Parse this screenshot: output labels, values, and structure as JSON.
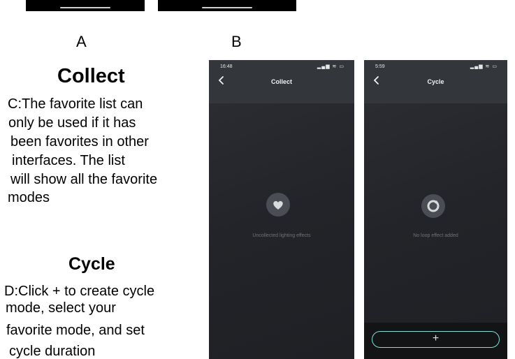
{
  "labels": {
    "a": "A",
    "b": "B"
  },
  "collect": {
    "title": "Collect",
    "lines": [
      "C:The favorite list can",
      "only  be used if it has",
      "been favorites in other",
      "interfaces. The list",
      "will show all the favorite",
      "modes"
    ]
  },
  "cycle": {
    "title": "Cycle",
    "lines": [
      "D:Click + to create cycle",
      "mode, select your",
      "favorite mode, and set",
      "cycle duration"
    ]
  },
  "phone_collect": {
    "time": "16:48",
    "title": "Collect",
    "empty_text": "Uncollected lighting effects",
    "empty_icon": "heart-icon"
  },
  "phone_cycle": {
    "time": "5:59",
    "title": "Cycle",
    "empty_text": "No loop effect added",
    "empty_icon": "loop-icon",
    "add_label": "+"
  },
  "colors": {
    "accent": "#7fe0d8",
    "phone_bg": "#25272c",
    "header_bg": "#33363b"
  }
}
